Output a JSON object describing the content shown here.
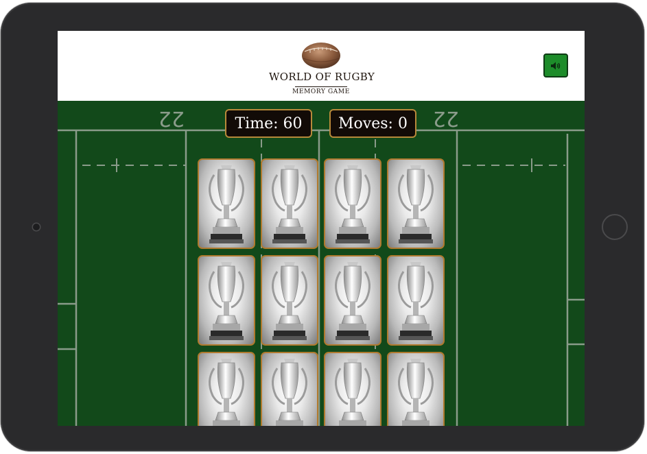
{
  "header": {
    "logo_title": "WORLD OF RUGBY",
    "logo_subtitle": "MEMORY GAME",
    "sound_icon": "volume-up-icon"
  },
  "field": {
    "left_22_marking": "22",
    "right_22_marking": "22"
  },
  "hud": {
    "time_label": "Time: 60",
    "moves_label": "Moves: 0"
  },
  "cards": {
    "face_down_icon": "trophy-icon",
    "count_visible": 12,
    "grid_columns": 4
  },
  "colors": {
    "pitch": "#12491a",
    "sound_button": "#1d8c2a",
    "card_border": "#b07a2e",
    "hud_background": "#120b07",
    "hud_border": "#b8893a"
  }
}
